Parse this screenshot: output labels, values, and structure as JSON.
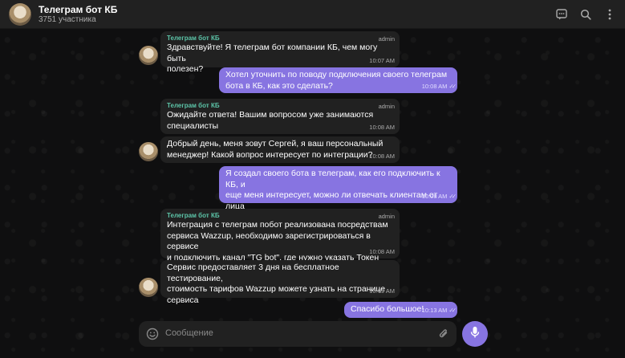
{
  "header": {
    "title": "Телеграм бот КБ",
    "subtitle": "3751 участника"
  },
  "messages": [
    {
      "sender": "Телеграм бот КБ",
      "role": "admin",
      "lines": [
        "Здравствуйте! Я телеграм бот компании КБ, чем могу быть",
        "полезен?"
      ],
      "time": "10:07 AM"
    },
    {
      "lines": [
        "Хотел уточнить по поводу подключения своего телеграм",
        "бота в КБ, как это сделать?"
      ],
      "time": "10:08 AM"
    },
    {
      "sender": "Телеграм бот КБ",
      "role": "admin",
      "lines": [
        "Ожидайте ответа! Вашим вопросом уже занимаются",
        "специалисты"
      ],
      "time": "10:08 AM"
    },
    {
      "lines": [
        "Добрый день, меня зовут Сергей, я ваш персональный",
        "менеджер! Какой вопрос интересует по интеграции?"
      ],
      "time": "10:08 AM"
    },
    {
      "lines": [
        "Я создал своего бота в телеграм, как его подключить к КБ, и",
        "еще меня интересует, можно ли отвечать клиентам от лица",
        "бота?"
      ],
      "time": "10:08 AM"
    },
    {
      "sender": "Телеграм бот КБ",
      "role": "admin",
      "lines": [
        "Интеграция с телеграм побот реализована посредствам",
        "сервиса Wazzup, необходимо зарегистрироваться в сервисе",
        "и подключить канал \"TG bot\", где нужно указать Токен бота"
      ],
      "time": "10:08 AM"
    },
    {
      "lines": [
        "Сервис предоставляет 3 дня на бесплатное тестирование,",
        "стоимость тарифов Wazzup можете узнать на странице",
        "сервиса"
      ],
      "time": "10:09 AM"
    },
    {
      "lines": [
        "Спасибо большое!"
      ],
      "time": "10:13 AM"
    }
  ],
  "composer": {
    "placeholder": "Сообщение"
  },
  "icons": {
    "header": [
      "chat-icon",
      "search-icon",
      "more-icon"
    ],
    "composer": [
      "emoji-icon",
      "attach-icon",
      "mic-icon"
    ]
  },
  "colors": {
    "accent": "#8774e1",
    "sender_name": "#5cc4a8",
    "incoming_bubble": "#212121"
  }
}
